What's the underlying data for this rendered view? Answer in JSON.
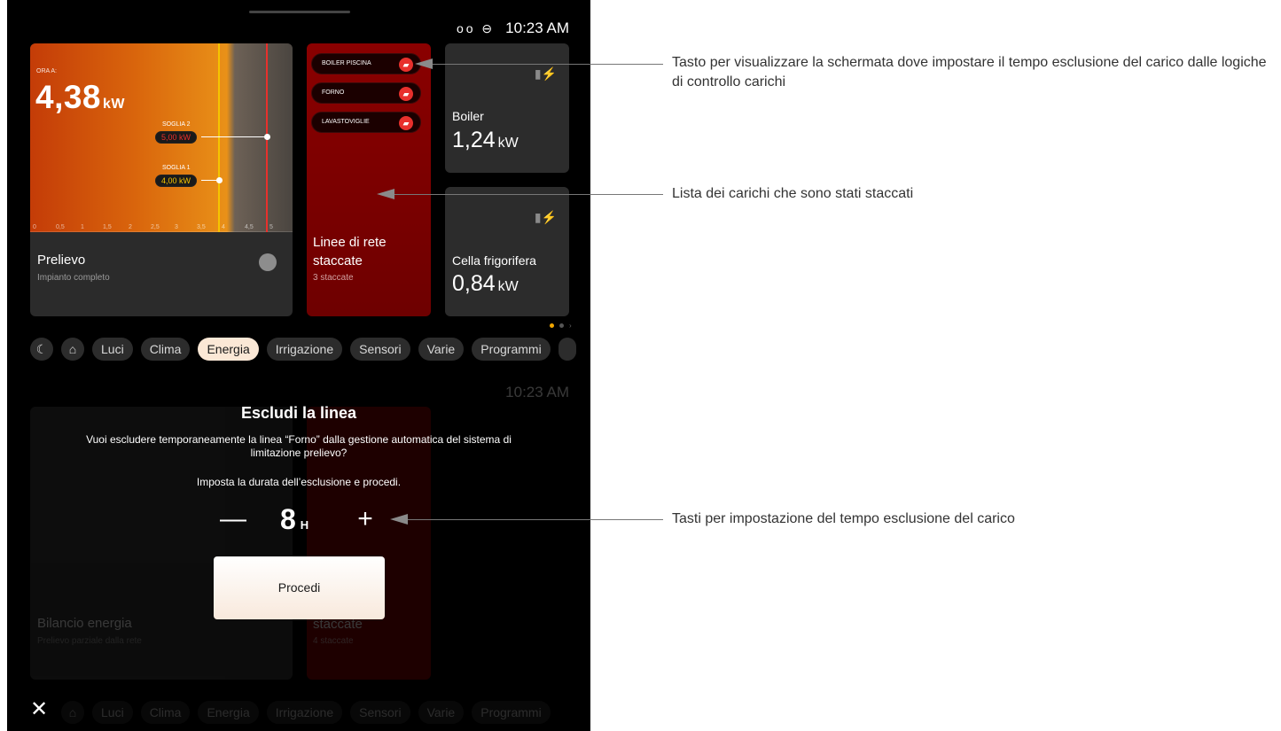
{
  "status_bar": {
    "time": "10:23 AM",
    "icons": "voicemail-icon, do-not-disturb-icon"
  },
  "prelievo_card": {
    "now_label": "ORA A:",
    "value": "4,38",
    "unit": "kW",
    "soglia2_label": "SOGLIA 2",
    "soglia2_value": "5,00 kW",
    "soglia1_label": "SOGLIA 1",
    "soglia1_value": "4,00 kW",
    "ticks": [
      "0",
      "0,5",
      "1",
      "1,5",
      "2",
      "2,5",
      "3",
      "3,5",
      "4",
      "4,5",
      "5"
    ],
    "title": "Prelievo",
    "subtitle": "Impianto completo",
    "colors": {
      "low": "#c43c08",
      "high": "#e99118",
      "soglia1": "#f5c400",
      "soglia2": "#e8302c"
    }
  },
  "linee_card": {
    "loads": [
      {
        "label": "BOILER PISCINA"
      },
      {
        "label": "FORNO"
      },
      {
        "label": "LAVASTOVIGLIE"
      }
    ],
    "title_line1": "Linee di rete",
    "title_line2": "staccate",
    "subtitle": "3 staccate"
  },
  "boiler_card": {
    "title": "Boiler",
    "value": "1,24",
    "unit": "kW"
  },
  "cella_card": {
    "title": "Cella frigorifera",
    "value": "0,84",
    "unit": "kW"
  },
  "tabs": [
    "Luci",
    "Clima",
    "Energia",
    "Irrigazione",
    "Sensori",
    "Varie",
    "Programmi"
  ],
  "active_tab": "Energia",
  "background_screen": {
    "time": "10:23 AM",
    "card1_title": "Bilancio energia",
    "card1_sub": "Prelievo parziale dalla rete",
    "card2_title": "staccate",
    "card2_sub": "4 staccate"
  },
  "modal": {
    "title": "Escludi la linea",
    "text": "Vuoi escludere temporaneamente la linea “Forno” dalla gestione automatica del sistema di limitazione prelievo?",
    "text2": "Imposta la durata dell’esclusione e procedi.",
    "minus": "—",
    "plus": "+",
    "hours": "8",
    "hours_unit": "H",
    "button": "Procedi"
  },
  "annotations": {
    "a1": "Tasto per visualizzare la schermata dove impostare il tempo esclusione del carico dalle logiche di controllo carichi",
    "a2": "Lista dei carichi che sono stati staccati",
    "a3": "Tasti per impostazione del tempo esclusione del carico"
  }
}
